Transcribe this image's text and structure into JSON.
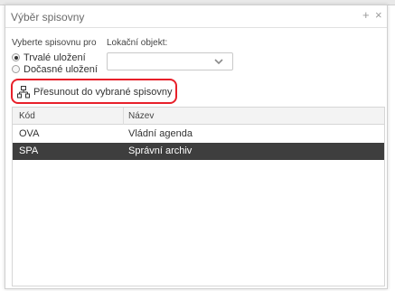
{
  "dialog": {
    "title": "Výběr spisovny",
    "icons": {
      "add": "plus-icon",
      "close": "close-icon"
    }
  },
  "form": {
    "pick_label": "Vyberte spisovnu pro",
    "location_label": "Lokační objekt:",
    "options": [
      {
        "label": "Trvalé uložení",
        "selected": true
      },
      {
        "label": "Dočasné uložení",
        "selected": false
      }
    ],
    "location_value": ""
  },
  "move_button": {
    "label": "Přesunout do vybrané spisovny",
    "icon": "hierarchy-icon"
  },
  "table": {
    "columns": [
      "Kód",
      "Název"
    ],
    "rows": [
      {
        "code": "OVA",
        "name": "Vládní agenda",
        "selected": false
      },
      {
        "code": "SPA",
        "name": "Správní archiv",
        "selected": true
      }
    ]
  },
  "colors": {
    "selected_row": "#3e3e3e",
    "highlight": "#e8202a"
  }
}
